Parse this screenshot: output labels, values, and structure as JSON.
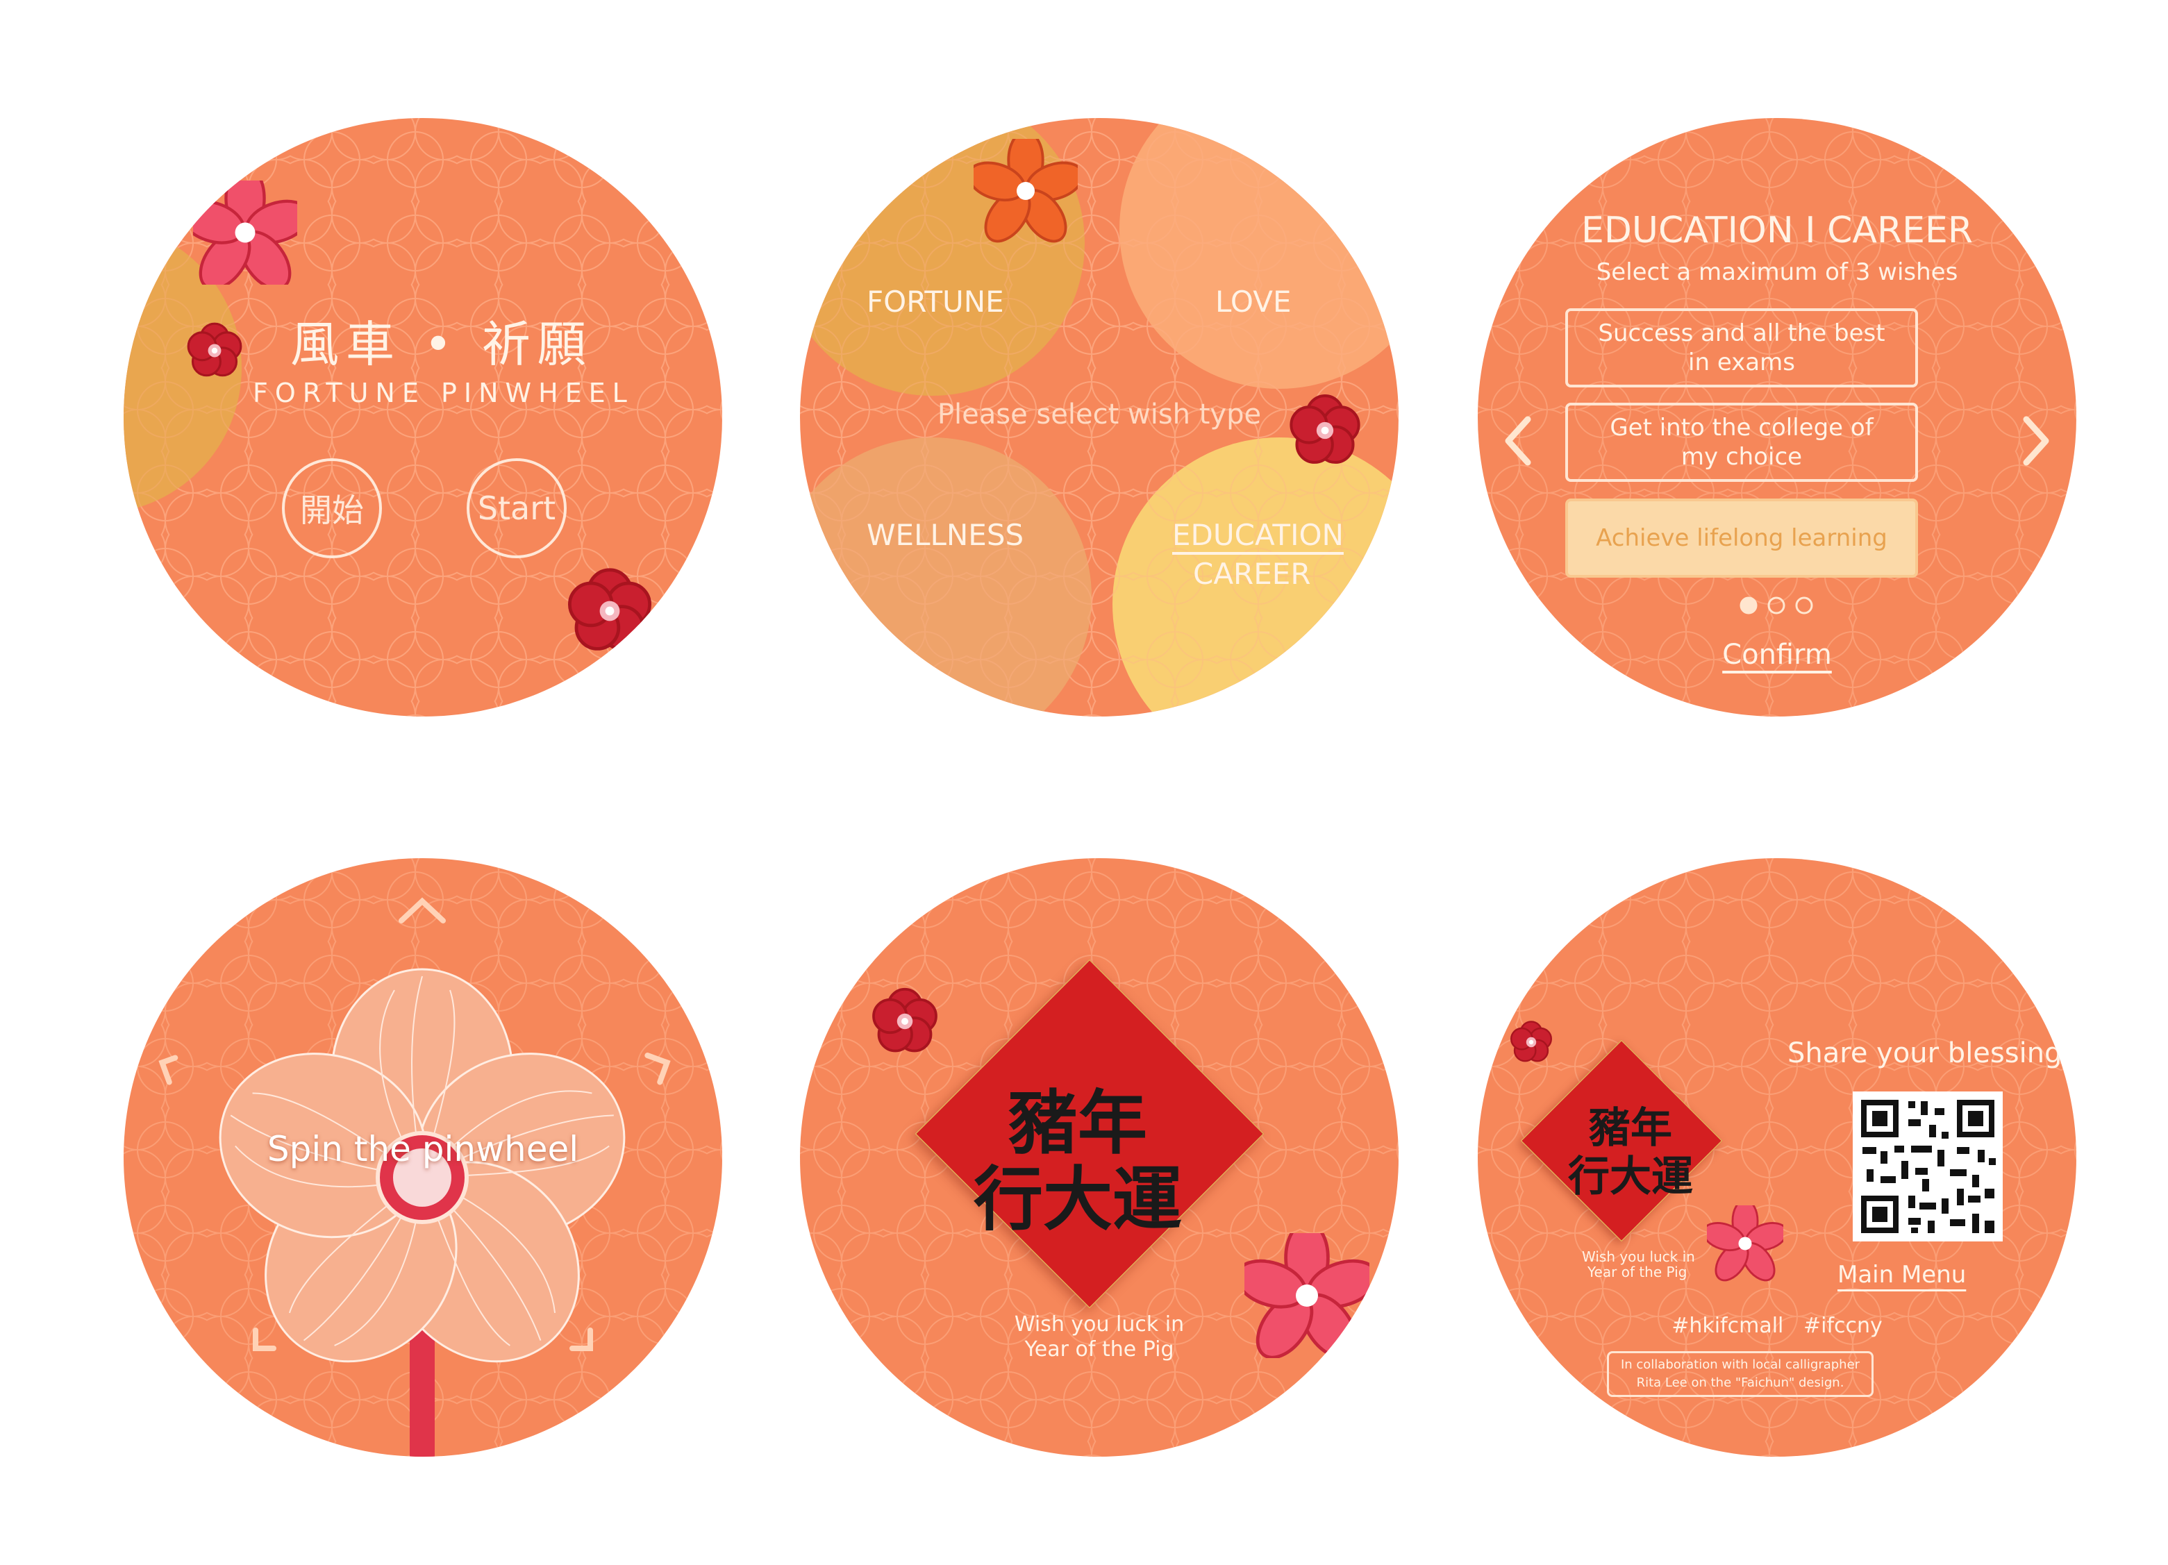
{
  "colors": {
    "bg_orange": "#F6875A",
    "mustard": "#E9A64F",
    "light_peach": "#FBA874",
    "pale_yellow": "#F9CF72",
    "fu_red": "#D41F21",
    "flower_pink": "#F05A6A",
    "text_cream": "#FFF3E6"
  },
  "screen1": {
    "title_zh": "風車 • 祈願",
    "title_en": "FORTUNE PINWHEEL",
    "start_zh": "開始",
    "start_en": "Start"
  },
  "screen2": {
    "fortune": "FORTUNE",
    "love": "LOVE",
    "prompt": "Please select wish type",
    "wellness": "WELLNESS",
    "education": "EDUCATION",
    "career": "CAREER"
  },
  "screen3": {
    "title": "EDUCATION I CAREER",
    "subtitle": "Select a maximum of 3 wishes",
    "wishes": [
      {
        "label": "Success and all the best\nin exams",
        "selected": false
      },
      {
        "label": "Get into the college of\nmy choice",
        "selected": false
      },
      {
        "label": "Achieve lifelong learning",
        "selected": true
      }
    ],
    "page_count": 3,
    "page_active": 1,
    "confirm": "Confirm",
    "prev_icon": "chevron-left-icon",
    "next_icon": "chevron-right-icon"
  },
  "screen4": {
    "instruction": "Spin the pinwheel"
  },
  "screen5": {
    "fu_line1": "豬年",
    "fu_line2": "行大運",
    "wish_line1": "Wish you luck in",
    "wish_line2": "Year of the Pig"
  },
  "screen6": {
    "share": "Share your blessing",
    "fu_line1": "豬年",
    "fu_line2": "行大運",
    "card_wish_line1": "Wish you luck in",
    "card_wish_line2": "Year of the Pig",
    "main_menu": "Main Menu",
    "hashtags": "#hkifcmall   #ifccny",
    "credit_line1": "In collaboration with local calligrapher",
    "credit_line2": "Rita Lee on the \"Faichun\" design."
  }
}
